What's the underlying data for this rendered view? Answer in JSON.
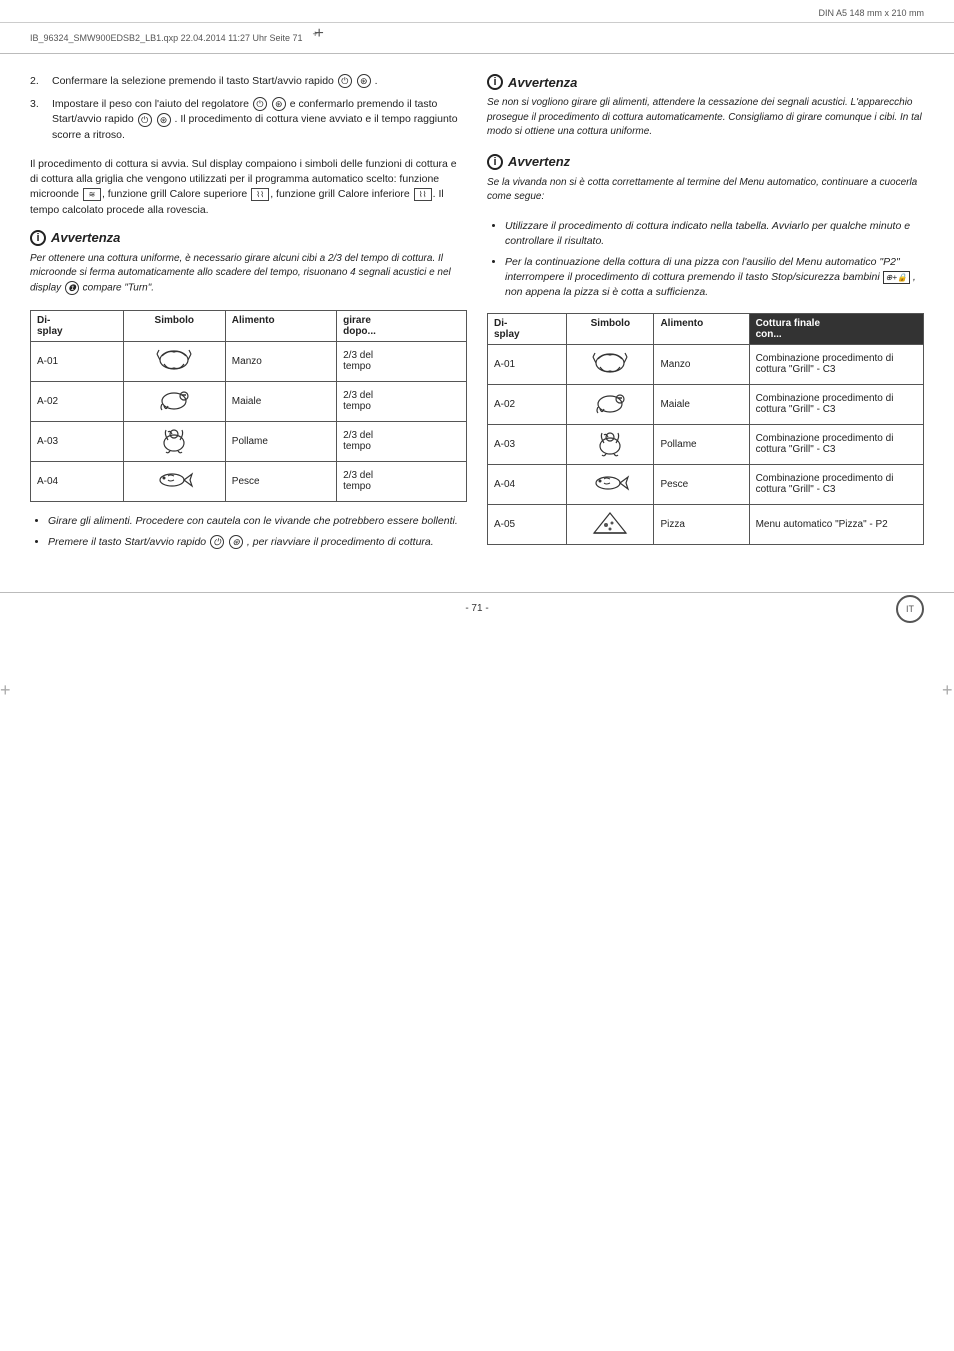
{
  "page": {
    "document_info": "DIN A5 148 mm x 210 mm",
    "file_stamp": "IB_96324_SMW900EDSB2_LB1.qxp   22.04.2014   11:27 Uhr   Seite 71",
    "footer_page": "- 71 -",
    "footer_logo": "IT"
  },
  "left": {
    "steps": [
      {
        "num": "2.",
        "text": "Confermare la selezione premendo il tasto Start/avvio rapido  ."
      },
      {
        "num": "3.",
        "text": "Impostare il peso con l'aiuto del regolatore   e confermarlo premendo il tasto Start/avvio rapido  . Il procedimento di cottura viene avviato e il tempo raggiunto scorre a ritroso."
      }
    ],
    "body1": "Il procedimento di cottura si avvia. Sul display compaiono i simboli delle funzioni di cottura e di cottura alla griglia che vengono utilizzati per il programma automatico scelto: funzione microonde , funzione grill Calore superiore , funzione grill Calore inferiore . Il tempo calcolato procede alla rovescia.",
    "note1": {
      "title": "Avvertenza",
      "body": "Per ottenere una cottura uniforme, è necessario girare alcuni cibi a 2/3 del tempo di cottura. Il microonde si ferma automaticamente allo scadere del tempo, risuonano 4 segnali acustici e nel display  compare \"Turn\"."
    },
    "table": {
      "headers": [
        "Di-\nsplay",
        "Simbolo",
        "Alimento",
        "girare\ndopo..."
      ],
      "rows": [
        {
          "display": "A-01",
          "symbol": "🥩",
          "alimento": "Manzo",
          "girare": "2/3 del\ntempo"
        },
        {
          "display": "A-02",
          "symbol": "🐷",
          "alimento": "Maiale",
          "girare": "2/3 del\ntempo"
        },
        {
          "display": "A-03",
          "symbol": "🐔",
          "alimento": "Pollame",
          "girare": "2/3 del\ntempo"
        },
        {
          "display": "A-04",
          "symbol": "🐟",
          "alimento": "Pesce",
          "girare": "2/3 del\ntempo"
        }
      ]
    },
    "bullets": [
      "Girare gli alimenti. Procedere con cautela con le vivande che potrebbero essere bollenti.",
      "Premere il tasto Start/avvio rapido   , per riavviare il procedimento di cottura."
    ]
  },
  "right": {
    "note2": {
      "title": "Avvertenza",
      "body": "Se non si vogliono girare gli alimenti, attendere la cessazione dei segnali acustici. L'apparecchio prosegue il procedimento di cottura automaticamente. Consigliamo di girare comunque i cibi. In tal modo si ottiene una cottura uniforme."
    },
    "note3": {
      "title": "Avvertenz",
      "body": "Se la vivanda non si è cotta correttamente al termine del Menu automatico, continuare a cuocerla come segue:"
    },
    "bullets2": [
      "Utilizzare il procedimento di cottura indicato nella tabella. Avviarlo per qualche minuto e controllare il risultato.",
      "Per la continuazione della cottura di una pizza con l'ausilio del Menu automatico \"P2\" interrompere il procedimento di cottura premendo il tasto Stop/sicurezza bambini  , non appena la pizza si è cotta a sufficienza."
    ],
    "table2": {
      "headers": [
        "Di-\nsplay",
        "Simbolo",
        "Alimento",
        "Cottura finale\ncon..."
      ],
      "rows": [
        {
          "display": "A-01",
          "symbol": "🥩",
          "alimento": "Manzo",
          "cottura": "Combinazione procedimento di cottura \"Grill\" - C3"
        },
        {
          "display": "A-02",
          "symbol": "🐷",
          "alimento": "Maiale",
          "cottura": "Combinazione procedimento di cottura \"Grill\" - C3"
        },
        {
          "display": "A-03",
          "symbol": "🐔",
          "alimento": "Pollame",
          "cottura": "Combinazione procedimento di cottura \"Grill\" - C3"
        },
        {
          "display": "A-04",
          "symbol": "🐟",
          "alimento": "Pesce",
          "cottura": "Combinazione procedimento di cottura \"Grill\" - C3"
        },
        {
          "display": "A-05",
          "symbol": "🍕",
          "alimento": "Pizza",
          "cottura": "Menu automatico \"Pizza\" - P2"
        }
      ]
    }
  }
}
